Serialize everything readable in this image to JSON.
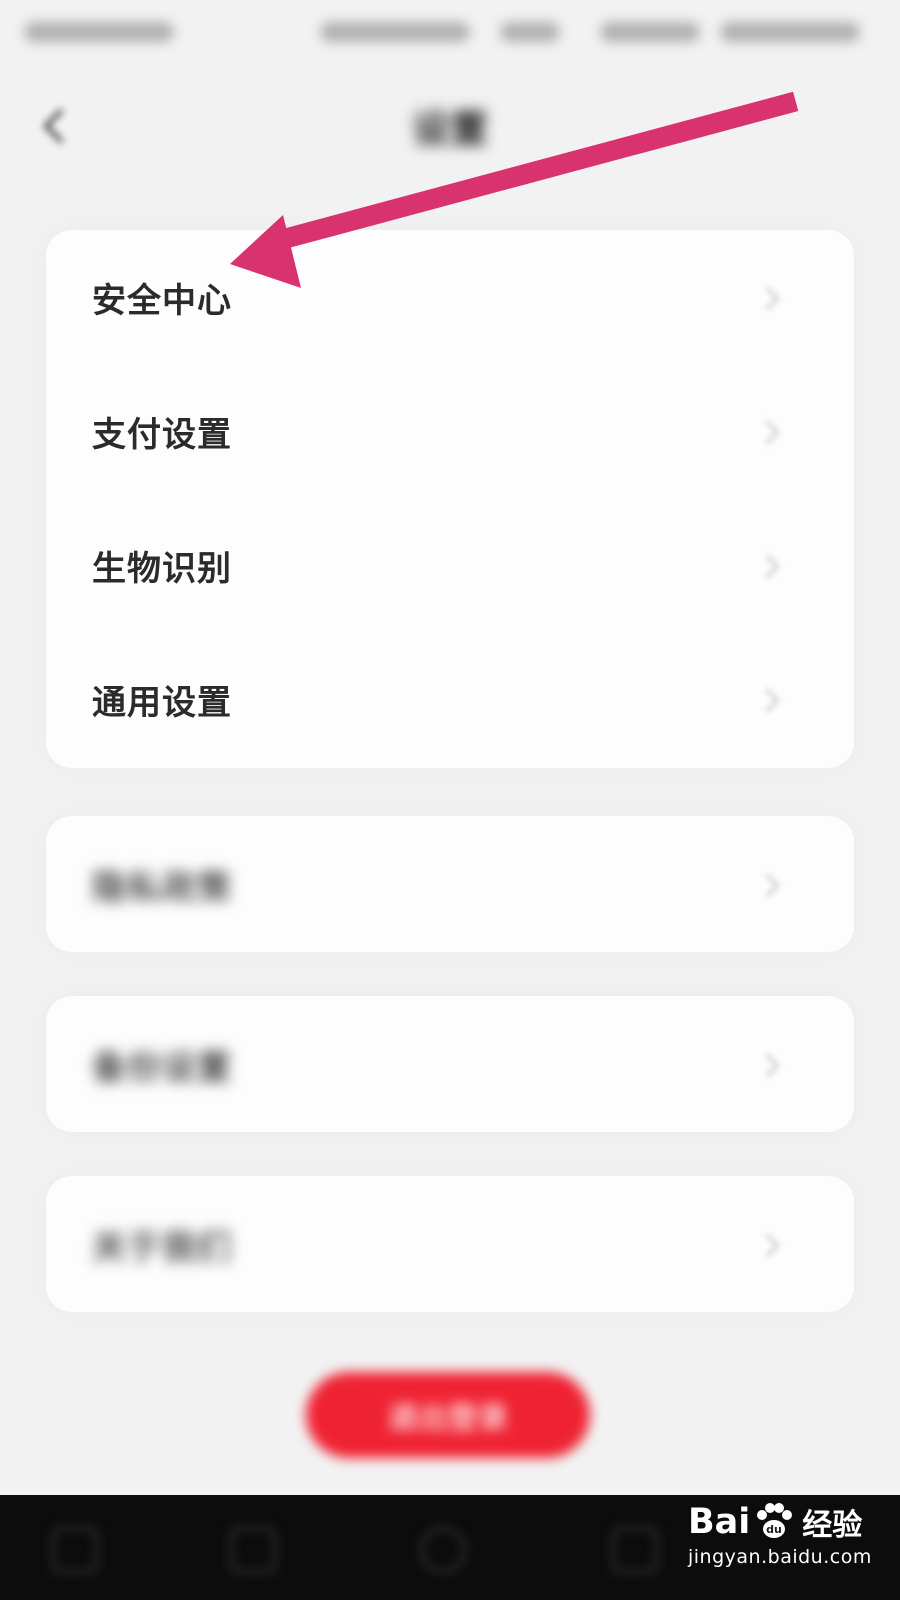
{
  "header": {
    "title": "设置",
    "back_icon": "chevron-left-icon"
  },
  "settings_group": {
    "items": [
      {
        "label": "安全中心",
        "icon": "chevron-right-icon"
      },
      {
        "label": "支付设置",
        "icon": "chevron-right-icon"
      },
      {
        "label": "生物识别",
        "icon": "chevron-right-icon"
      },
      {
        "label": "通用设置",
        "icon": "chevron-right-icon"
      }
    ]
  },
  "other_groups": [
    {
      "label": "隐私政策",
      "icon": "chevron-right-icon"
    },
    {
      "label": "备份设置",
      "icon": "chevron-right-icon"
    },
    {
      "label": "关于我们",
      "icon": "chevron-right-icon"
    }
  ],
  "logout": {
    "label": "退出登录"
  },
  "annotation": {
    "color": "#d8336f",
    "points_to": "安全中心"
  },
  "watermark": {
    "brand": "Bai",
    "brand_suffix": "经验",
    "url": "jingyan.baidu.com"
  },
  "colors": {
    "background": "#f2f2f2",
    "card": "#fdfdfd",
    "logout": "#ef2232",
    "nav_bar": "#0c0c0c"
  }
}
